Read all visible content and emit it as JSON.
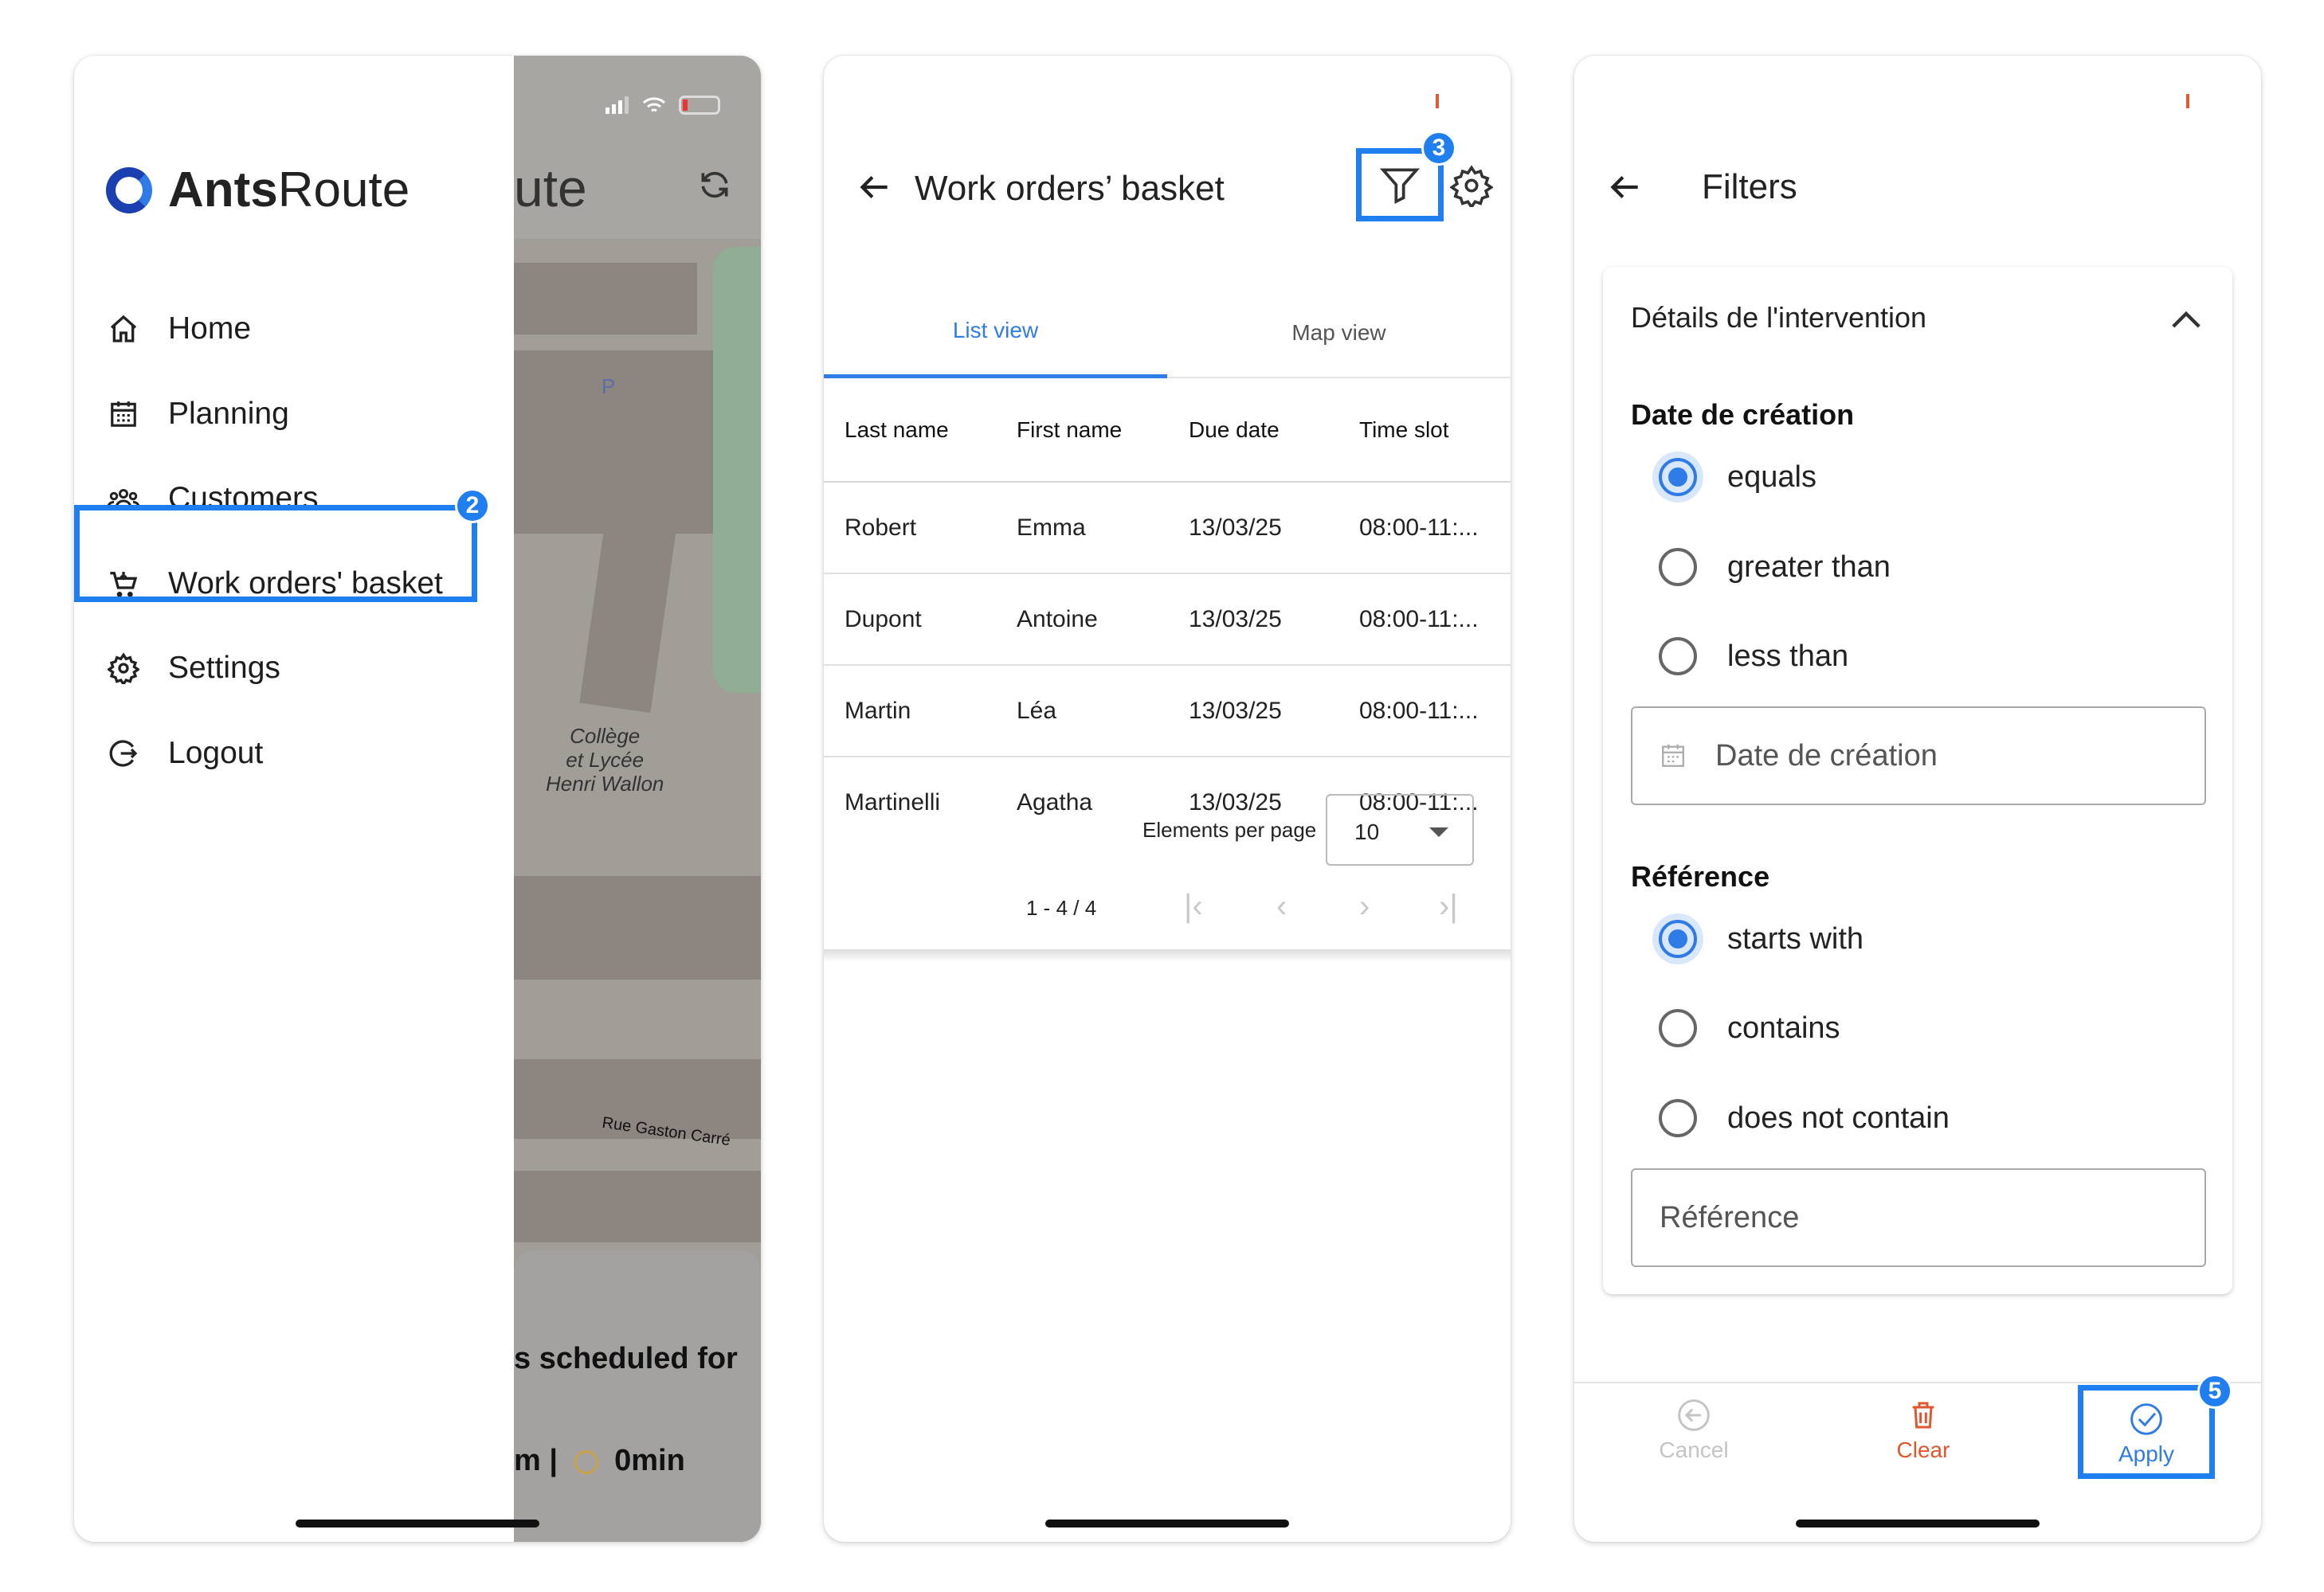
{
  "screen1": {
    "status_bar": {
      "signal": "signal-icon",
      "wifi": "wifi-icon",
      "battery": "battery-icon"
    },
    "app_title_partial": "ute",
    "refresh_icon": "refresh-icon",
    "logo": {
      "text_bold": "Ants",
      "text_regular": "Route"
    },
    "menu": [
      {
        "label": "Home",
        "icon": "home-icon"
      },
      {
        "label": "Planning",
        "icon": "calendar-icon"
      },
      {
        "label": "Customers",
        "icon": "customers-icon"
      },
      {
        "label": "Work orders' basket",
        "icon": "basket-icon"
      },
      {
        "label": "Settings",
        "icon": "gear-icon"
      },
      {
        "label": "Logout",
        "icon": "logout-icon"
      }
    ],
    "step_badge": "2",
    "map_labels": {
      "school": "Collège\net Lycée\nHenri Wallon",
      "street": "Rue Gaston Carré",
      "parking": "P"
    },
    "scheduled_text": "s scheduled for",
    "duration_text": "m |",
    "duration_value": "0min",
    "colors": {
      "accent": "#1f7ff0",
      "logo_dark": "#1a3fb0"
    }
  },
  "screen2": {
    "title": "Work orders’ basket",
    "step_badge": "3",
    "tabs": [
      "List view",
      "Map view"
    ],
    "active_tab": "List view",
    "columns": [
      "Last name",
      "First name",
      "Due date",
      "Time slot"
    ],
    "rows": [
      [
        "Robert",
        "Emma",
        "13/03/25",
        "08:00-11:..."
      ],
      [
        "Dupont",
        "Antoine",
        "13/03/25",
        "08:00-11:..."
      ],
      [
        "Martin",
        "Léa",
        "13/03/25",
        "08:00-11:..."
      ],
      [
        "Martinelli",
        "Agatha",
        "13/03/25",
        "08:00-11:..."
      ]
    ],
    "pagination": {
      "label": "Elements per page",
      "per_page": "10",
      "range": "1 - 4 / 4"
    }
  },
  "screen3": {
    "title": "Filters",
    "section": "Détails de l'intervention",
    "creation_date": {
      "title": "Date de création",
      "options": [
        "equals",
        "greater than",
        "less than"
      ],
      "selected": "equals",
      "placeholder": "Date de création"
    },
    "reference": {
      "title": "Référence",
      "options": [
        "starts with",
        "contains",
        "does not contain"
      ],
      "selected": "starts with",
      "placeholder": "Référence"
    },
    "actions": {
      "cancel": "Cancel",
      "clear": "Clear",
      "apply": "Apply"
    },
    "step_badge": "5",
    "colors": {
      "apply": "#2f7be8",
      "clear": "#e0562f",
      "cancel": "#c4c4c4"
    }
  }
}
